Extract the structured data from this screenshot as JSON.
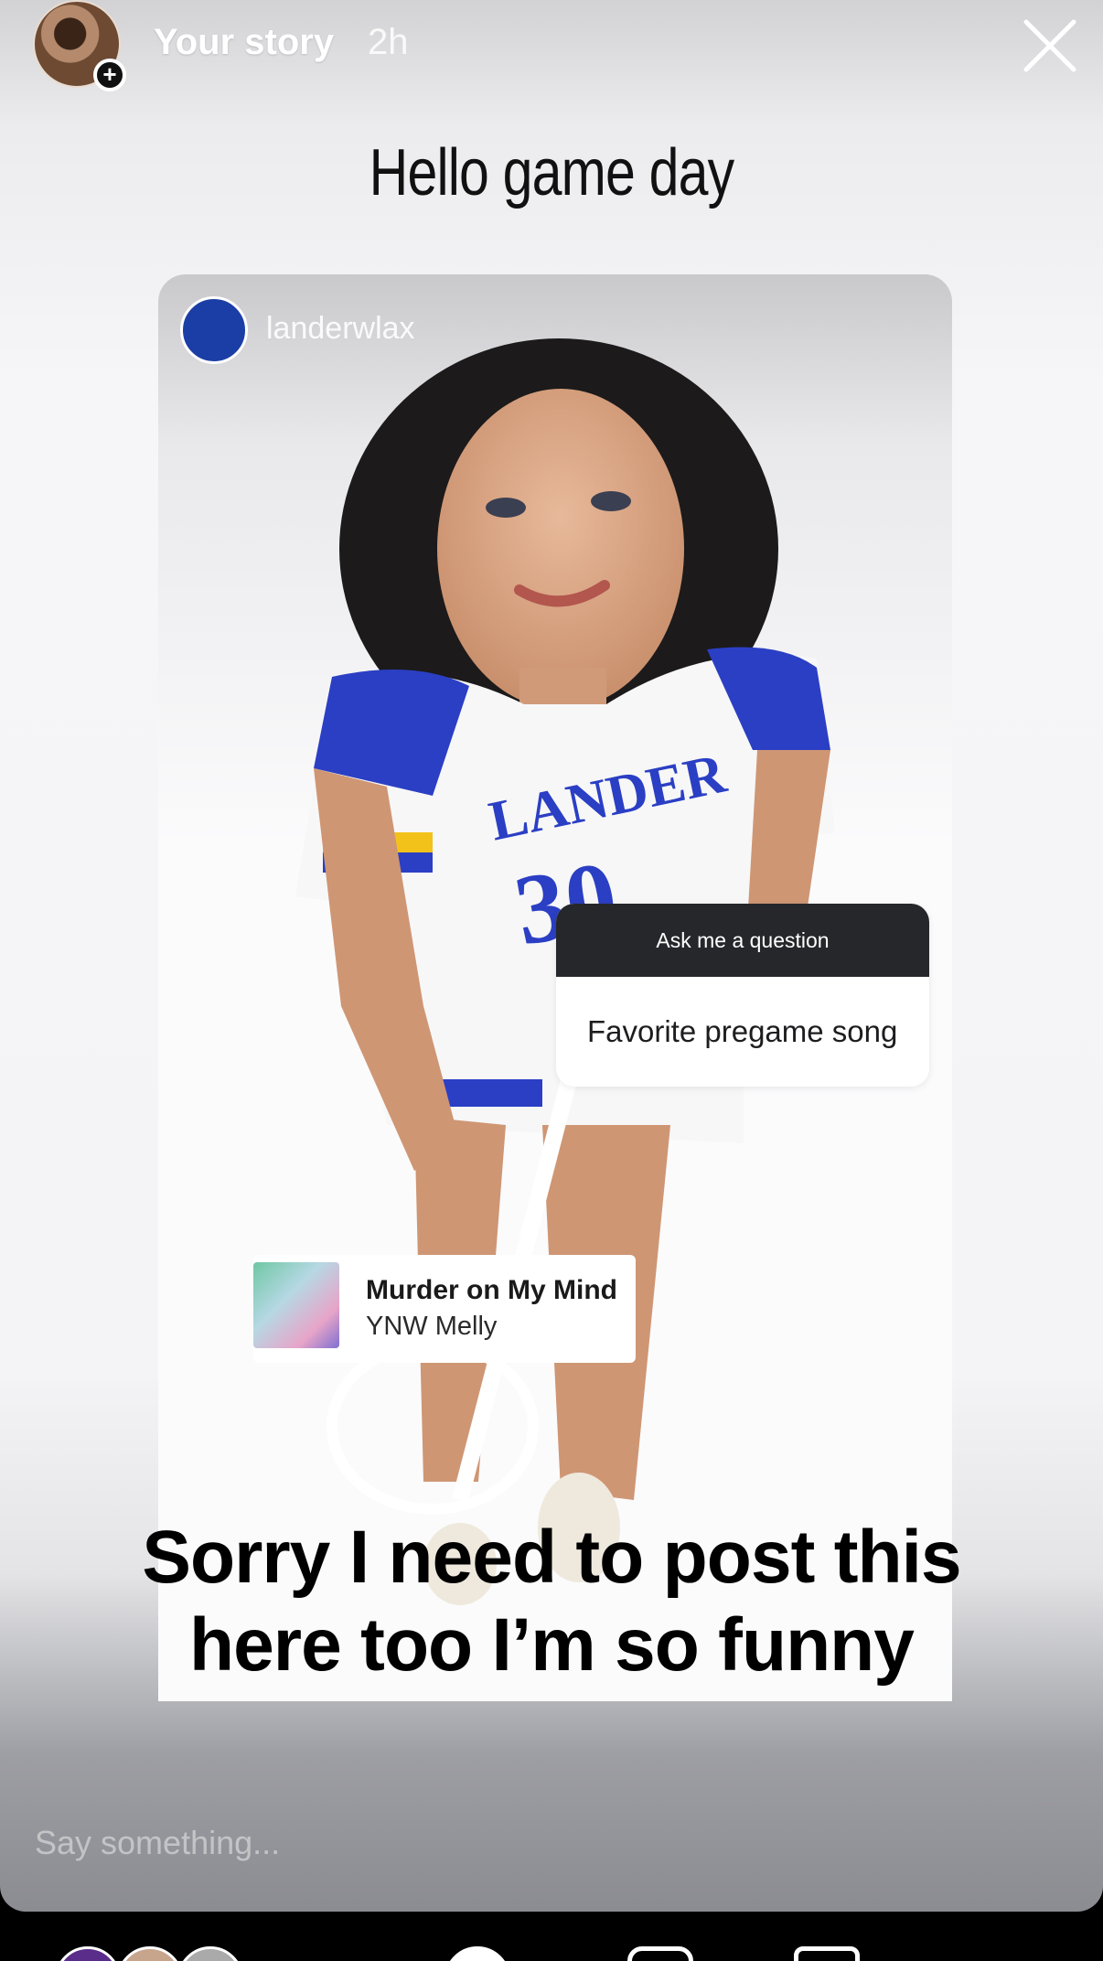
{
  "header": {
    "owner": "Your story",
    "time": "2h",
    "add_icon": "plus-icon",
    "close_icon": "close-icon"
  },
  "headline": "Hello game day",
  "post": {
    "handle": "landerwlax",
    "question_sticker": {
      "header": "Ask me a question",
      "text": "Favorite pregame song"
    },
    "music_sticker": {
      "title": "Murder on My Mind",
      "artist": "YNW Melly"
    }
  },
  "caption": {
    "line1": "Sorry I need to post this",
    "line2": "here too I’m so funny"
  },
  "reply": {
    "placeholder": "Say something..."
  },
  "colors": {
    "jersey_blue": "#2b3fc4",
    "jersey_gold": "#f2c21b",
    "sticker_header": "#26272b"
  }
}
